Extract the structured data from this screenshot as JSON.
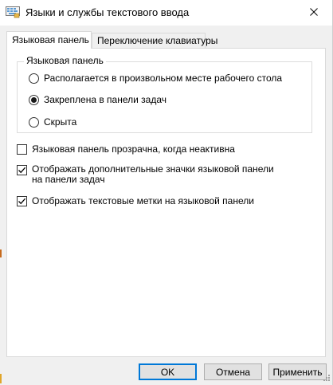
{
  "window": {
    "title": "Языки и службы текстового ввода",
    "icon": "keyboard-language-icon",
    "close_icon": "close-icon"
  },
  "tabs": [
    {
      "label": "Языковая панель",
      "active": true
    },
    {
      "label": "Переключение клавиатуры",
      "active": false
    }
  ],
  "language_bar": {
    "group_title": "Языковая панель",
    "position_options": [
      {
        "label": "Располагается в произвольном месте рабочего стола",
        "checked": false
      },
      {
        "label": "Закреплена в панели задач",
        "checked": true
      },
      {
        "label": "Скрыта",
        "checked": false
      }
    ],
    "checkboxes": [
      {
        "label": "Языковая панель прозрачна, когда неактивна",
        "checked": false
      },
      {
        "label": "Отображать дополнительные значки языковой панели на панели задач",
        "checked": true
      },
      {
        "label": "Отображать текстовые метки на языковой панели",
        "checked": true
      }
    ]
  },
  "buttons": {
    "ok": "OK",
    "cancel": "Отмена",
    "apply": "Применить"
  },
  "colors": {
    "accent": "#0078d7",
    "dialog_bg": "#f0f0f0",
    "panel_bg": "#ffffff"
  }
}
